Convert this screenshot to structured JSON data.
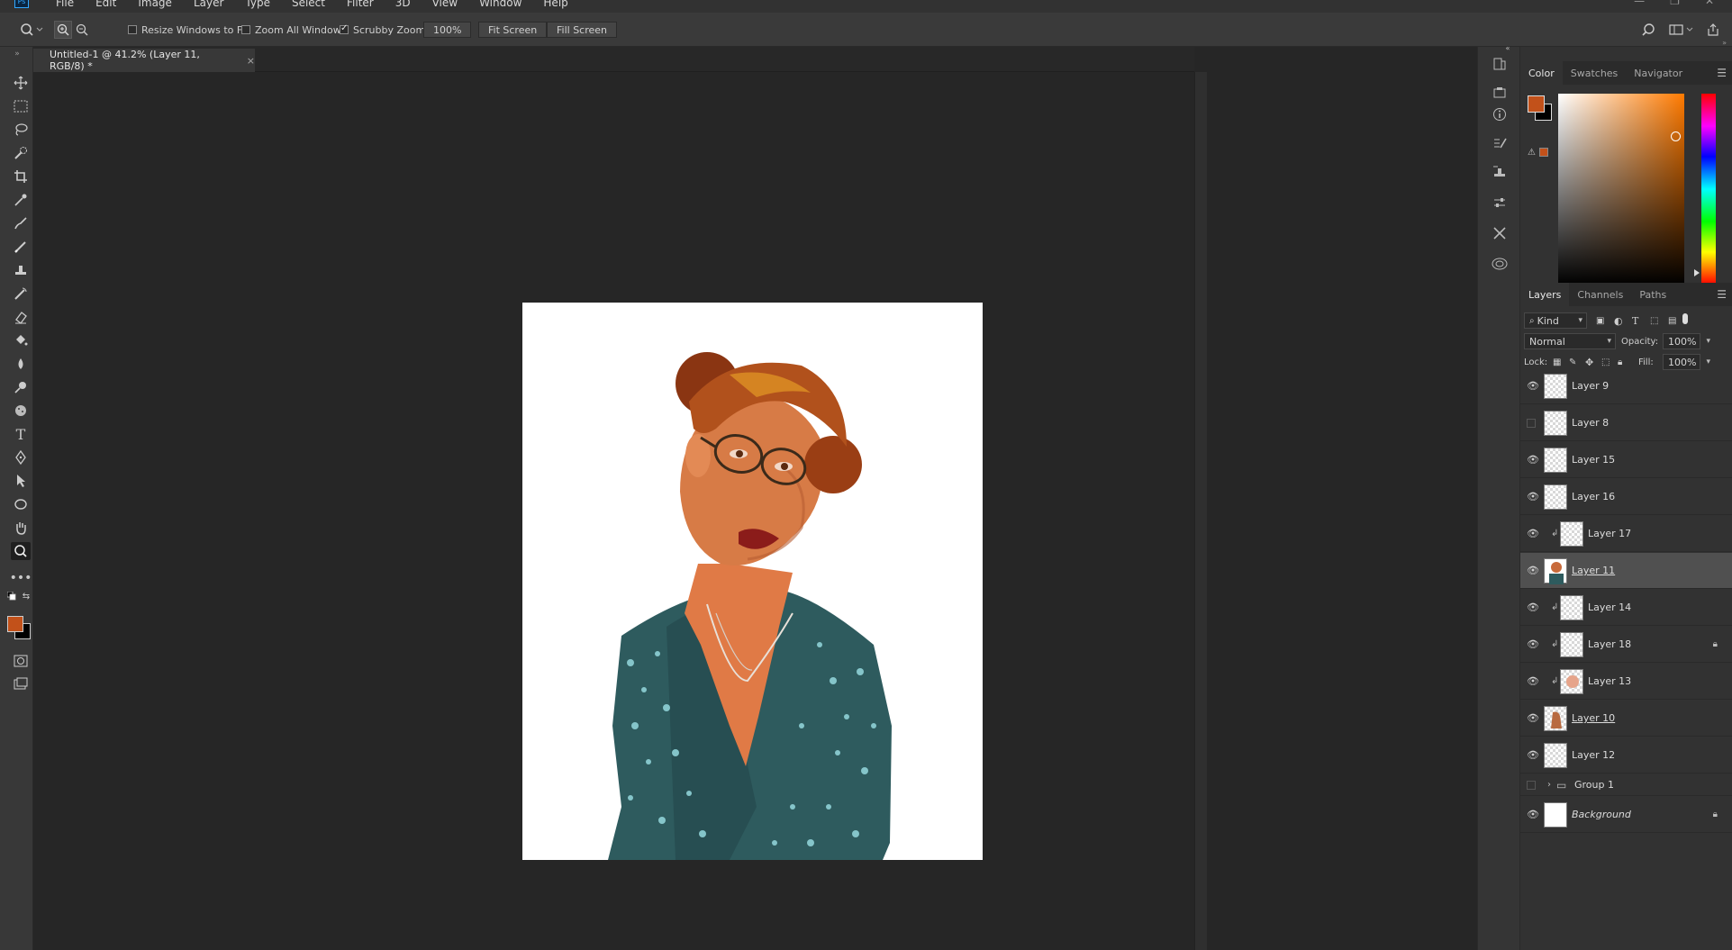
{
  "app": {
    "menus": [
      "File",
      "Edit",
      "Image",
      "Layer",
      "Type",
      "Select",
      "Filter",
      "3D",
      "View",
      "Window",
      "Help"
    ],
    "logo_text": "Ps"
  },
  "options": {
    "resize_windows_label": "Resize Windows to Fit",
    "resize_windows_checked": false,
    "zoom_all_label": "Zoom All Windows",
    "zoom_all_checked": false,
    "scrubby_zoom_label": "Scrubby Zoom",
    "scrubby_zoom_checked": true,
    "zoom_value": "100%",
    "fit_screen_label": "Fit Screen",
    "fill_screen_label": "Fill Screen"
  },
  "document": {
    "tab_title": "Untitled-1 @ 41.2% (Layer 11, RGB/8) *",
    "close_glyph": "×"
  },
  "color_panel": {
    "tabs": [
      "Color",
      "Swatches",
      "Navigator"
    ],
    "active_tab": "Color",
    "foreground": "#c2511a",
    "background": "#000000"
  },
  "layers_panel": {
    "tabs": [
      "Layers",
      "Channels",
      "Paths"
    ],
    "active_tab": "Layers",
    "filter_kind": "Kind",
    "blend_mode": "Normal",
    "opacity_label": "Opacity:",
    "opacity_value": "100%",
    "lock_label": "Lock:",
    "fill_label": "Fill:",
    "fill_value": "100%",
    "layers": [
      {
        "name": "Layer 9",
        "visible": true,
        "clipped": false,
        "locked": false,
        "selected": false,
        "thumb": "transparent"
      },
      {
        "name": "Layer 8",
        "visible": false,
        "clipped": false,
        "locked": false,
        "selected": false,
        "thumb": "transparent"
      },
      {
        "name": "Layer 15",
        "visible": true,
        "clipped": false,
        "locked": false,
        "selected": false,
        "thumb": "transparent"
      },
      {
        "name": "Layer 16",
        "visible": true,
        "clipped": false,
        "locked": false,
        "selected": false,
        "thumb": "transparent"
      },
      {
        "name": "Layer 17",
        "visible": true,
        "clipped": true,
        "locked": false,
        "selected": false,
        "thumb": "transparent"
      },
      {
        "name": "Layer 11",
        "visible": true,
        "clipped": false,
        "locked": false,
        "selected": true,
        "thumb": "portrait"
      },
      {
        "name": "Layer 14",
        "visible": true,
        "clipped": true,
        "locked": false,
        "selected": false,
        "thumb": "transparent"
      },
      {
        "name": "Layer 18",
        "visible": true,
        "clipped": true,
        "locked": true,
        "selected": false,
        "thumb": "transparent"
      },
      {
        "name": "Layer 13",
        "visible": true,
        "clipped": true,
        "locked": false,
        "selected": false,
        "thumb": "skin"
      },
      {
        "name": "Layer 10",
        "visible": true,
        "clipped": false,
        "locked": false,
        "selected": false,
        "thumb": "figure"
      },
      {
        "name": "Layer 12",
        "visible": true,
        "clipped": false,
        "locked": false,
        "selected": false,
        "thumb": "transparent"
      },
      {
        "name": "Group 1",
        "visible": false,
        "clipped": false,
        "locked": false,
        "selected": false,
        "thumb": "folder"
      },
      {
        "name": "Background",
        "visible": true,
        "clipped": false,
        "locked": true,
        "selected": false,
        "thumb": "white"
      }
    ]
  }
}
